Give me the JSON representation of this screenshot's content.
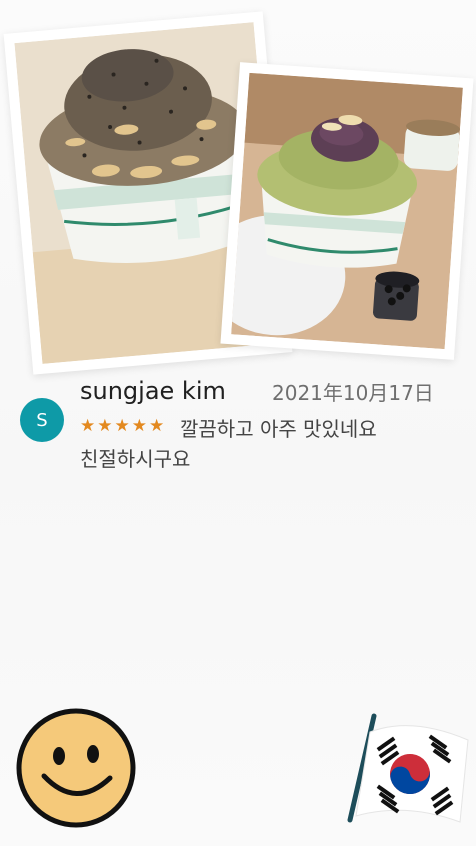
{
  "review": {
    "avatar_initial": "S",
    "reviewer_name": "sungjae kim",
    "date": "2021年10月17日",
    "stars": "★★★★★",
    "rating": 5,
    "text_line1": "깔끔하고 아주 맛있네요",
    "text_line2": "친절하시구요"
  },
  "colors": {
    "avatar_bg": "#0e9aa7",
    "star": "#e3891f",
    "background": "#f8f8f8"
  },
  "icons": {
    "photo1": "bingsu-black-sesame-photo",
    "photo2": "bingsu-green-tea-photo",
    "sticker_left": "smiley-face-icon",
    "sticker_right": "korean-flag-icon"
  }
}
